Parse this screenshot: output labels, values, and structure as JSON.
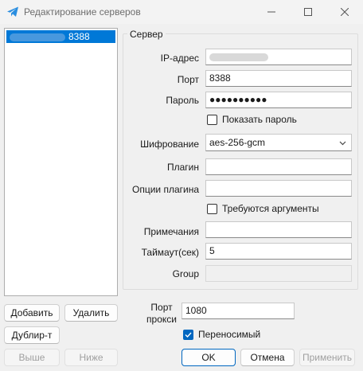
{
  "window": {
    "title": "Редактирование серверов",
    "minimize_icon": "minimize-icon",
    "maximize_icon": "maximize-icon",
    "close_icon": "close-icon",
    "app_icon": "paper-plane-icon"
  },
  "server_list": {
    "items": [
      {
        "label": "8388",
        "selected": true
      }
    ]
  },
  "server_group": {
    "title": "Сервер",
    "ip_label": "IP-адрес",
    "ip_value": "",
    "port_label": "Порт",
    "port_value": "8388",
    "password_label": "Пароль",
    "password_value": "●●●●●●●●●●",
    "show_password_label": "Показать пароль",
    "encryption_label": "Шифрование",
    "encryption_value": "aes-256-gcm",
    "plugin_label": "Плагин",
    "plugin_value": "",
    "plugin_options_label": "Опции плагина",
    "plugin_options_value": "",
    "requires_args_label": "Требуются аргументы",
    "notes_label": "Примечания",
    "notes_value": "",
    "timeout_label": "Таймаут(сек)",
    "timeout_value": "5",
    "group_label": "Group",
    "group_value": ""
  },
  "list_buttons": {
    "add": "Добавить",
    "delete": "Удалить",
    "duplicate": "Дублир-т",
    "up": "Выше",
    "down": "Ниже"
  },
  "proxy": {
    "label": "Порт прокси",
    "value": "1080",
    "portable_label": "Переносимый",
    "portable_checked": true
  },
  "dialog_buttons": {
    "ok": "OK",
    "cancel": "Отмена",
    "apply": "Применить"
  },
  "colors": {
    "accent": "#0078d7",
    "checkbox_accent": "#0067c0",
    "background": "#f0f0f0"
  }
}
